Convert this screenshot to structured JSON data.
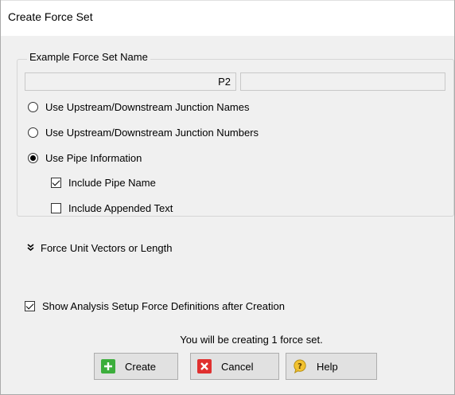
{
  "dialog": {
    "title": "Create Force Set"
  },
  "example_group": {
    "legend": "Example Force Set Name",
    "name_field_value": "P2",
    "appended_field_value": "",
    "options": [
      {
        "label": "Use Upstream/Downstream Junction Names",
        "selected": false
      },
      {
        "label": "Use Upstream/Downstream Junction Numbers",
        "selected": false
      },
      {
        "label": "Use Pipe Information",
        "selected": true
      }
    ],
    "include_pipe_name": {
      "label": "Include Pipe Name",
      "checked": true
    },
    "include_appended_text": {
      "label": "Include Appended Text",
      "checked": false
    }
  },
  "expander": {
    "label": "Force Unit Vectors or Length"
  },
  "show_after_creation": {
    "label": "Show Analysis Setup Force Definitions after Creation",
    "checked": true
  },
  "info_text": "You will be creating 1 force set.",
  "buttons": {
    "create": "Create",
    "cancel": "Cancel",
    "help": "Help"
  },
  "colors": {
    "create_icon": "#3cae3c",
    "cancel_icon": "#e0302f",
    "help_icon": "#f2c230"
  }
}
